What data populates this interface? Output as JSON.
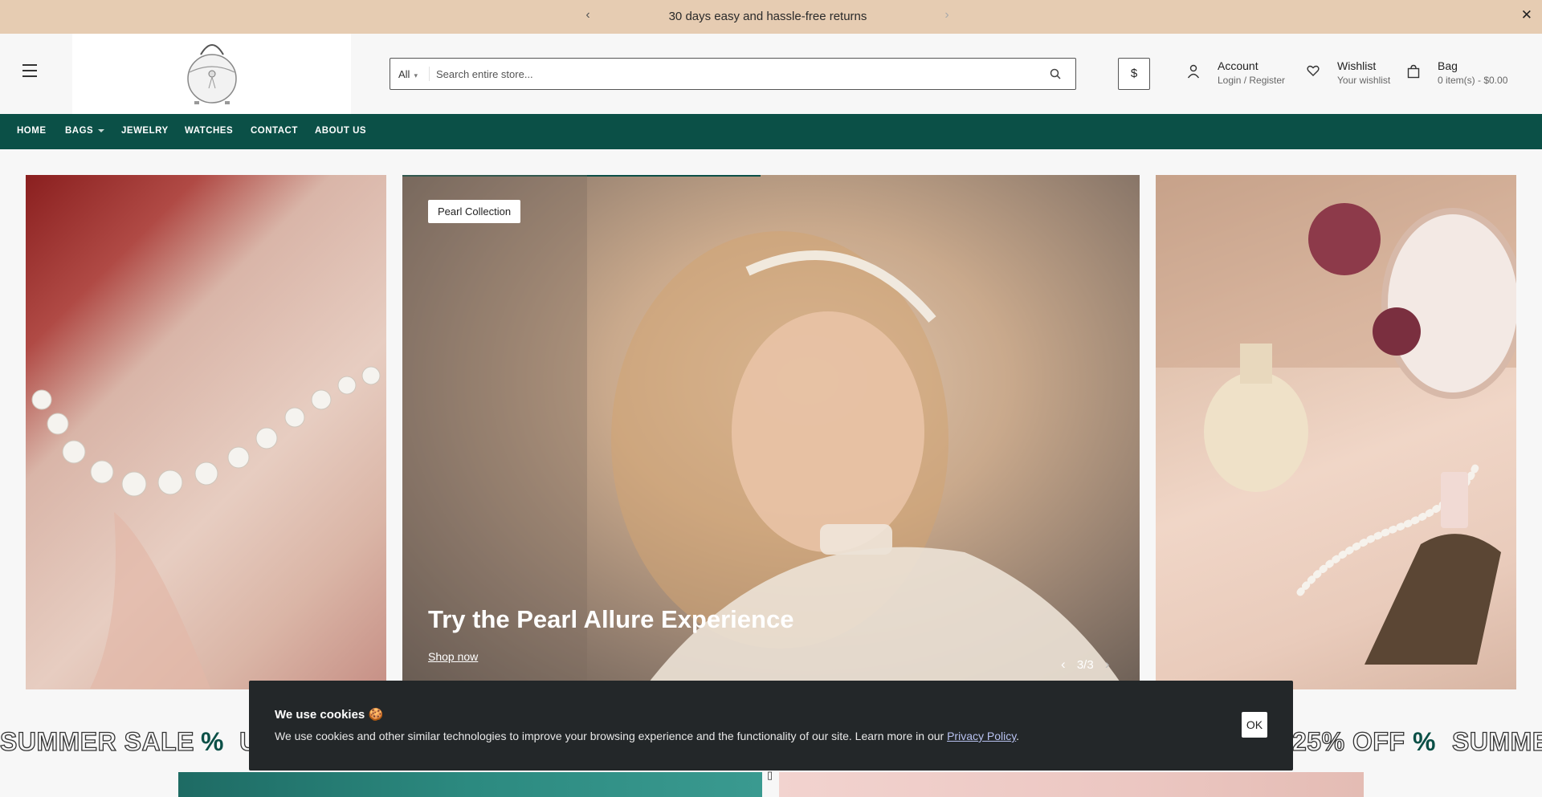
{
  "announcement": {
    "message": "30 days easy and hassle-free returns",
    "prev_icon": "chevron-left-icon",
    "next_icon": "chevron-right-icon",
    "close_icon": "close-icon"
  },
  "header": {
    "menu_icon": "hamburger-icon",
    "logo_icon": "bag-logo-icon",
    "search": {
      "category": "All",
      "placeholder": "Search entire store..."
    },
    "currency": "$",
    "account": {
      "title": "Account",
      "subtitle": "Login / Register",
      "icon": "user-icon"
    },
    "wishlist": {
      "title": "Wishlist",
      "subtitle": "Your wishlist",
      "icon": "heart-icon"
    },
    "bag": {
      "title": "Bag",
      "subtitle": "0 item(s) - $0.00",
      "icon": "bag-icon"
    }
  },
  "nav": {
    "items": [
      {
        "label": "HOME"
      },
      {
        "label": "BAGS",
        "has_dropdown": true
      },
      {
        "label": "JEWELRY"
      },
      {
        "label": "WATCHES"
      },
      {
        "label": "CONTACT"
      },
      {
        "label": "ABOUT US"
      }
    ],
    "bg_color": "#0b5047"
  },
  "hero": {
    "badge": "Pearl Collection",
    "title": "Try the Pearl Allure Experience",
    "cta": "Shop now",
    "pager": "3/3",
    "slide_progress": 0.5
  },
  "marquee": {
    "items": [
      "SUMMER SALE",
      "%",
      "U",
      "25% OFF",
      "%",
      "SUMME"
    ]
  },
  "cookie": {
    "title": "We use cookies",
    "body": "We use cookies and other similar technologies to improve your browsing experience and the functionality of our site. Learn more in our",
    "link": "Privacy Policy",
    "period": ".",
    "ok": "OK"
  },
  "colors": {
    "announcement_bg": "#e6ccb2",
    "accent": "#0b5047",
    "cookie_bg": "#232729"
  }
}
